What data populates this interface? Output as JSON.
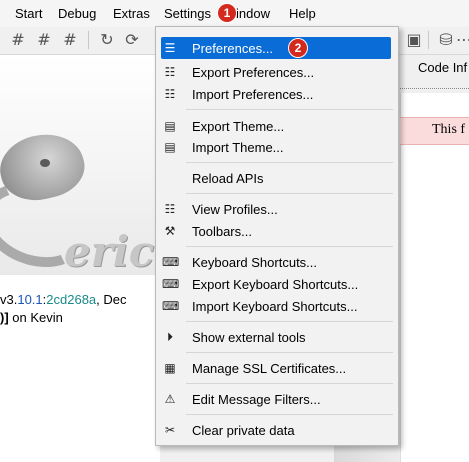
{
  "menubar": {
    "items": [
      "Start",
      "Debug",
      "Extras",
      "Settings",
      "Window",
      "Help"
    ],
    "window_visible": "indow",
    "badges": [
      "1",
      "2"
    ]
  },
  "toolbar": {
    "icons": [
      "hash-grid-icon",
      "hash-grid-icon",
      "hash-wand-icon",
      "redo-icon",
      "reload-icon",
      "save-table-icon",
      "database-add-icon"
    ]
  },
  "menu": {
    "items": [
      {
        "label": "Preferences...",
        "icon": "preferences-icon",
        "selected": true
      },
      {
        "label": "Export Preferences...",
        "icon": "export-preferences-icon"
      },
      {
        "label": "Import Preferences...",
        "icon": "import-preferences-icon"
      },
      {
        "label": "Export Theme...",
        "icon": "export-theme-icon"
      },
      {
        "label": "Import Theme...",
        "icon": "import-theme-icon"
      },
      {
        "label": "Reload APIs",
        "icon": ""
      },
      {
        "label": "View Profiles...",
        "icon": "view-profiles-icon"
      },
      {
        "label": "Toolbars...",
        "icon": "toolbars-icon"
      },
      {
        "label": "Keyboard Shortcuts...",
        "icon": "keyboard-icon"
      },
      {
        "label": "Export Keyboard Shortcuts...",
        "icon": "export-keyboard-icon"
      },
      {
        "label": "Import Keyboard Shortcuts...",
        "icon": "import-keyboard-icon"
      },
      {
        "label": "Show external tools",
        "icon": "play-circle-icon"
      },
      {
        "label": "Manage SSL Certificates...",
        "icon": "certificate-icon"
      },
      {
        "label": "Edit Message Filters...",
        "icon": "warning-icon"
      },
      {
        "label": "Clear private data",
        "icon": "broom-icon"
      }
    ]
  },
  "shell": {
    "line1_prefix": "v3.",
    "line1_ver": "10.1",
    "line1_colon": ":",
    "line1_hash": "2cd268a",
    "line1_suffix": ", Dec",
    "line2_bracket": ")]",
    "line2_text": " on Kevin"
  },
  "logo_text": "eric",
  "right": {
    "code_tab": "Code Inf",
    "pink_text": "This f"
  }
}
